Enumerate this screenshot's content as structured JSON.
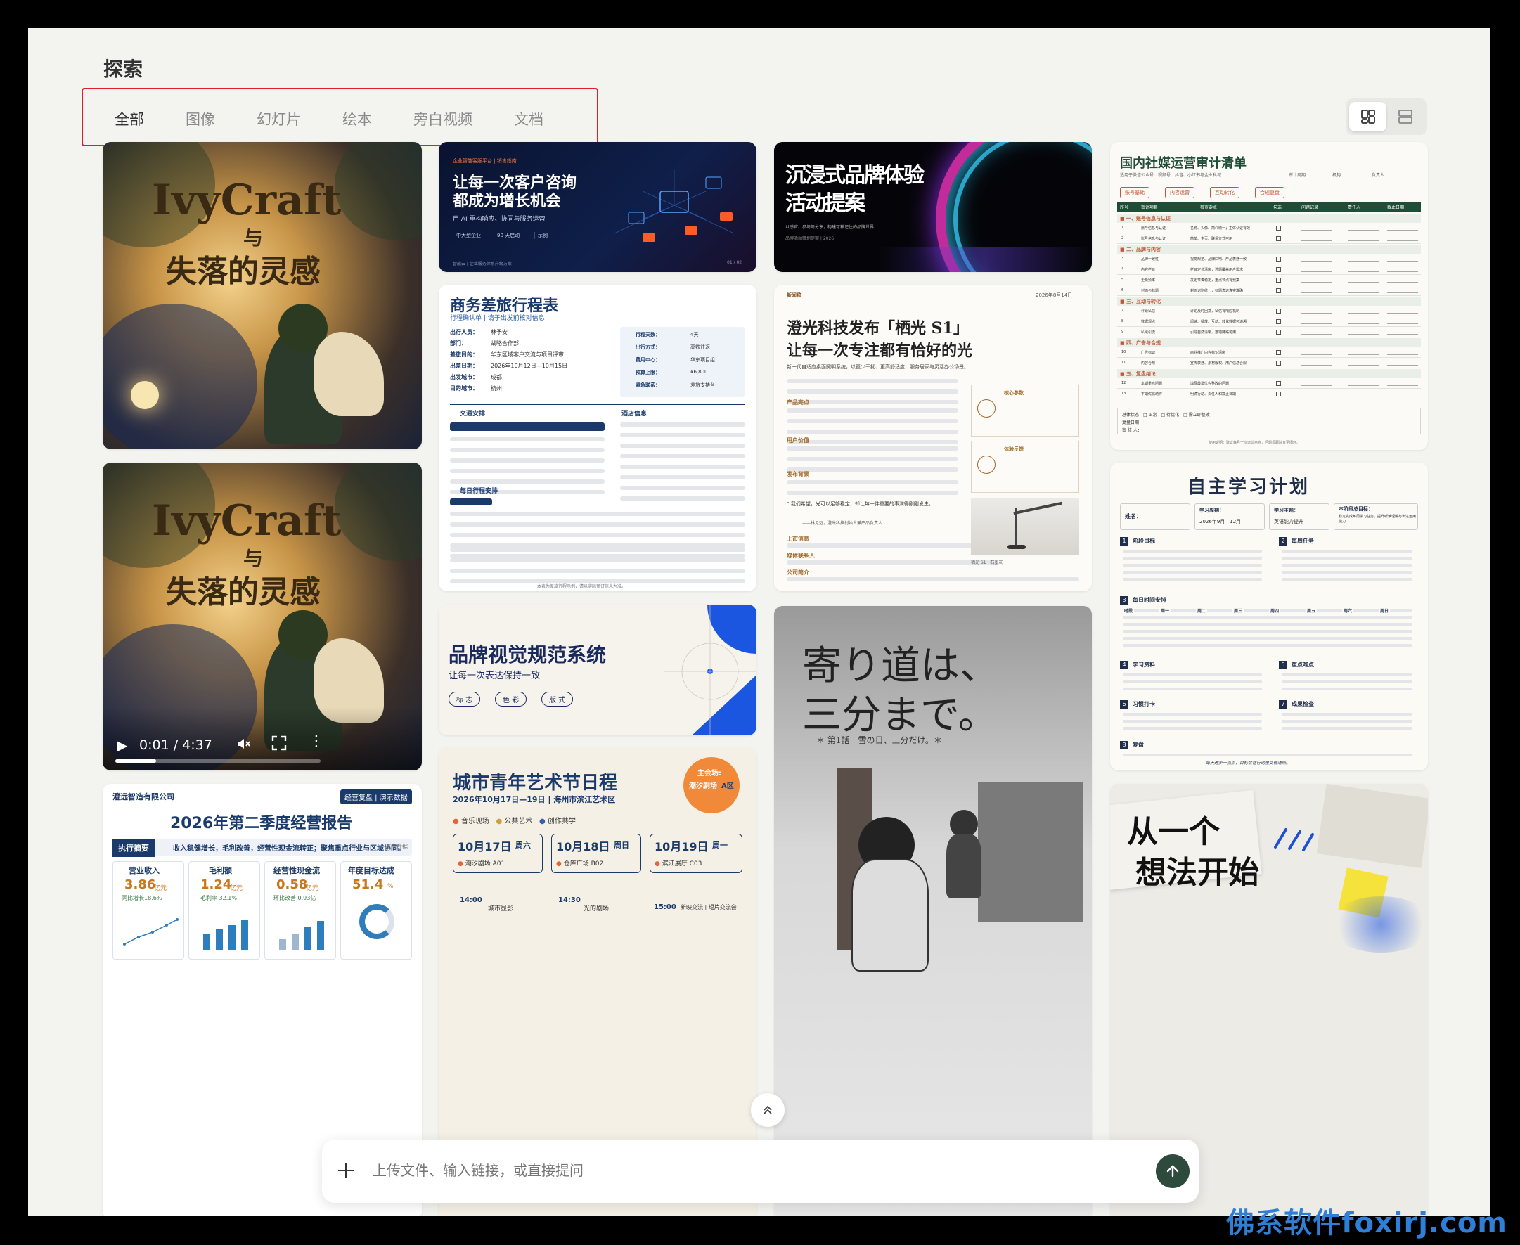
{
  "header": {
    "title": "探索"
  },
  "tabs": [
    {
      "label": "全部",
      "active": true
    },
    {
      "label": "图像",
      "active": false
    },
    {
      "label": "幻灯片",
      "active": false
    },
    {
      "label": "绘本",
      "active": false
    },
    {
      "label": "旁白视频",
      "active": false
    },
    {
      "label": "文档",
      "active": false
    }
  ],
  "view_toggle": {
    "icons": [
      "masonry-grid-icon",
      "list-layout-icon"
    ],
    "active": "masonry"
  },
  "cards": {
    "ivy1": {
      "title": "IvyCraft",
      "sub1": "与",
      "sub2": "失落的灵感"
    },
    "ivy2": {
      "title": "IvyCraft",
      "sub1": "与",
      "sub2": "失落的灵感",
      "time": "0:01 / 4:37",
      "progress": 0.2
    },
    "report": {
      "company": "澄远智造有限公司",
      "badge": "经营复盘 | 演示数据",
      "title": "2026年第二季度经营报告",
      "summary_label": "执行摘要",
      "summary": "收入稳健增长，毛利改善，经营性现金流转正；聚焦重点行业与区域协同。",
      "summary_tag": "演示数据",
      "kpis": [
        {
          "label": "营业收入",
          "value": "3.86",
          "unit": "亿元",
          "note": "同比增长18.6%"
        },
        {
          "label": "毛利额",
          "value": "1.24",
          "unit": "亿元",
          "note": "毛利率 32.1%"
        },
        {
          "label": "经营性现金流",
          "value": "0.58",
          "unit": "亿元",
          "note": "环比改善 0.93亿"
        },
        {
          "label": "年度目标达成",
          "value": "51.4",
          "unit": "%",
          "note": ""
        }
      ]
    },
    "slide_ai": {
      "kicker": "企业智能客服平台 | 销售指南",
      "line1": "让每一次客户咨询",
      "line2": "都成为增长机会",
      "sub": "用 AI 重构响应、协同与服务运营",
      "stats": [
        "中大型企业",
        "90 天启动",
        "示例"
      ],
      "footer": "智能云 | 企业服务体系升级方案",
      "page": "01 / 02"
    },
    "trip": {
      "title": "商务差旅行程表",
      "subtitle": "行程确认单 | 请于出发前核对信息",
      "fields": [
        {
          "k": "出行人员：",
          "v": "林予安"
        },
        {
          "k": "部门：",
          "v": "战略合作部"
        },
        {
          "k": "差旅目的：",
          "v": "华东区域客户交流与项目评审"
        },
        {
          "k": "出差日期：",
          "v": "2026年10月12日—10月15日"
        },
        {
          "k": "出发城市：",
          "v": "成都"
        },
        {
          "k": "目的城市：",
          "v": "杭州"
        }
      ],
      "side": [
        {
          "k": "行程天数：",
          "v": "4天"
        },
        {
          "k": "出行方式：",
          "v": "高铁往返"
        },
        {
          "k": "费用中心：",
          "v": "华东项目组"
        },
        {
          "k": "预算上限：",
          "v": "¥6,800"
        },
        {
          "k": "紧急联系：",
          "v": "差旅支持台"
        }
      ],
      "sec_transport": "交通安排",
      "sec_hotel": "酒店信息",
      "sec_daily": "每日行程安排",
      "footer": "本表为差旅行程示例，请以实际预订信息为准。"
    },
    "brand_event": {
      "line1": "沉浸式品牌体验",
      "line2": "活动提案",
      "sub": "以感官、参与与分享，构建可被记住的品牌世界",
      "footer": "品牌活动策划提案 | 2026"
    },
    "news": {
      "tag": "新闻稿",
      "date": "2026年8月14日",
      "title1": "澄光科技发布「栖光 S1」",
      "title2": "让每一次专注都有恰好的光",
      "lead": "新一代自适应桌面照明系统，以更少干扰、更高舒适度，服务居家与灵活办公场景。",
      "sections": [
        "产品亮点",
        "用户价值",
        "发布背景",
        "上市信息",
        "媒体联系人",
        "公司简介"
      ],
      "side_boxes": [
        "核心参数",
        "体验反馈"
      ],
      "quote": "我们希望，光可以足够稳定，却让每一件重要的事演得刚刚发生。",
      "quote_by": "——林见远，澄光科技创始人兼产品负责人",
      "lamp_caption": "栖光 S1 | 石墨灰"
    },
    "brand_vi": {
      "title": "品牌视觉规范系统",
      "sub": "让每一次表达保持一致",
      "chips": [
        "标 志",
        "色 彩",
        "版 式"
      ]
    },
    "festival": {
      "title": "城市青年艺术节日程",
      "date": "2026年10月17日—19日 | 海州市滨江艺术区",
      "badge1": "主会场:",
      "badge2": "潮汐剧场",
      "badge3": "A区",
      "legend": [
        "音乐现场",
        "公共艺术",
        "创作共学"
      ],
      "days": [
        {
          "d": "10月17日",
          "w": "周六",
          "venue": "潮汐剧场 A01"
        },
        {
          "d": "10月18日",
          "w": "周日",
          "venue": "仓库广场 B02"
        },
        {
          "d": "10月19日",
          "w": "周一",
          "venue": "滨江展厅 C03"
        }
      ],
      "times": [
        "14:00",
        "14:30",
        "15:00"
      ],
      "sessions": [
        "城市显影",
        "光的剧场",
        "新映交流 | 短片交流会"
      ]
    },
    "manga": {
      "title1": "寄り道は、",
      "title2": "三分まで。",
      "sub": "＊ 第1話　雪の日、三分だけ。＊"
    },
    "checklist": {
      "title": "国内社媒运营审计清单",
      "sub": "适用于微信公众号、视频号、抖音、小红书与企业私域",
      "fields": [
        "审计周期：",
        "机构：",
        "负责人："
      ],
      "chips": [
        "账号基础",
        "内容运营",
        "互动转化",
        "合规复盘"
      ],
      "headers": [
        "序号",
        "审计项目",
        "检查要点",
        "勾选",
        "问题记录",
        "责任人",
        "截止日期"
      ],
      "groups": [
        {
          "name": "一、账号信息与认证",
          "rows": [
            [
              "1",
              "账号信息与认证",
              "名称、头像、简介统一；主体认证有效"
            ],
            [
              "2",
              "账号信息与认证",
              "简单、主页、联系方式可用"
            ]
          ]
        },
        {
          "name": "二、品牌与内容",
          "rows": [
            [
              "3",
              "品牌一致性",
              "视觉规范、品牌口吻、产品表述一致"
            ],
            [
              "4",
              "内容栏目",
              "栏目定位清晰，选题覆盖用户需求"
            ],
            [
              "5",
              "更新频率",
              "发更节奏稳定，重点节点有预案"
            ],
            [
              "6",
              "封面与标题",
              "封面识别统一，标题表达真实准确"
            ]
          ]
        },
        {
          "name": "三、互动与转化",
          "rows": [
            [
              "7",
              "评论私信",
              "评论及时回复，私信有响应机制"
            ],
            [
              "8",
              "数据观点",
              "阅读、播放、互动、转化数据可追溯"
            ],
            [
              "9",
              "私域引流",
              "引导自然清晰，落地链路可用"
            ]
          ]
        },
        {
          "name": "四、广告与合规",
          "rows": [
            [
              "10",
              "广告标识",
              "商业推广内容标识清晰"
            ],
            [
              "11",
              "内容合规",
              "宣传表述、素材版权、用户信息合规"
            ]
          ]
        },
        {
          "name": "五、复盘结论",
          "rows": [
            [
              "12",
              "本期重点问题",
              "填写最需优先整改的问题"
            ],
            [
              "13",
              "下期优化动作",
              "明确行动、责任人和截止日期"
            ]
          ]
        }
      ],
      "total": "总体状态：□ 正常　□ 待优化　□ 需立即整改",
      "review_date": "复盘日期：",
      "reviewer": "审 核 人：",
      "footer": "使用说明：建议每月一次运营自查，问题须跟踪直至闭环。"
    },
    "study": {
      "title": "自主学习计划",
      "fields": [
        {
          "k": "姓名：",
          "v": ""
        },
        {
          "k": "学习周期：",
          "v": "2026年9月—12月"
        },
        {
          "k": "学习主题：",
          "v": "英语能力提升"
        },
        {
          "k": "本阶段总目标：",
          "v": "稳定完成每周学习任务，提升听读理解与表达运用能力"
        }
      ],
      "sections": [
        {
          "n": "1",
          "t": "阶段目标"
        },
        {
          "n": "2",
          "t": "每周任务"
        },
        {
          "n": "3",
          "t": "每日时间安排"
        },
        {
          "n": "4",
          "t": "学习资料"
        },
        {
          "n": "5",
          "t": "重点难点"
        },
        {
          "n": "6",
          "t": "习惯打卡"
        },
        {
          "n": "7",
          "t": "成果检查"
        },
        {
          "n": "8",
          "t": "复盘"
        }
      ],
      "week_days": [
        "时段",
        "周一",
        "周二",
        "周三",
        "周四",
        "周五",
        "周六",
        "周日"
      ],
      "footer": "每天进步一点点，目标会在行动里变得清晰。"
    },
    "idea": {
      "line1": "从一个",
      "line2": "想法开始"
    }
  },
  "scroll_top": {
    "icon": "double-chevron-up-icon"
  },
  "composer": {
    "placeholder": "上传文件、输入链接，或直接提问",
    "add_icon": "plus-icon",
    "send_icon": "arrow-up-icon"
  },
  "watermark": "佛系软件foxirj.com",
  "colors": {
    "accent_red": "#e11d2a",
    "navy": "#1a3a6b",
    "green_dark": "#1f4d36",
    "send_btn": "#2e4a3d"
  }
}
